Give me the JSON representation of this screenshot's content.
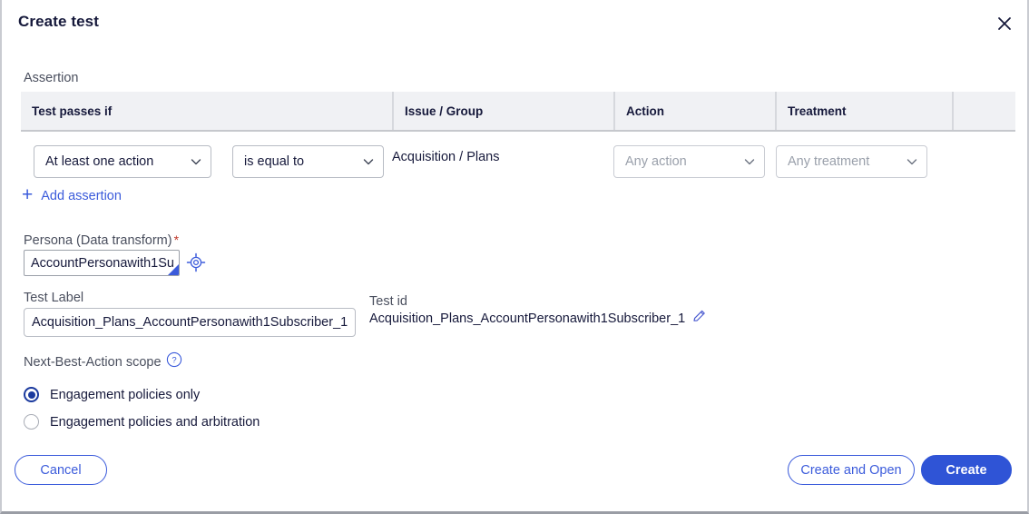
{
  "dialog": {
    "title": "Create test",
    "close_icon": "close-icon"
  },
  "assertion": {
    "section_label": "Assertion",
    "columns": [
      "Test passes if",
      "Issue / Group",
      "Action",
      "Treatment",
      ""
    ],
    "row": {
      "passes_if": "At least one action",
      "operator": "is equal to",
      "issue_group": "Acquisition / Plans",
      "action_placeholder": "Any action",
      "treatment_placeholder": "Any treatment"
    },
    "add_assertion_label": "Add assertion",
    "add_icon": "plus-icon"
  },
  "persona": {
    "label": "Persona (Data transform)",
    "required_mark": "*",
    "value": "AccountPersonawith1Su",
    "target_icon": "crosshair-target-icon"
  },
  "test_label": {
    "label": "Test Label",
    "value": "Acquisition_Plans_AccountPersonawith1Subscriber_1"
  },
  "test_id": {
    "label": "Test id",
    "value": "Acquisition_Plans_AccountPersonawith1Subscriber_1",
    "edit_icon": "pencil-edit-icon"
  },
  "nba_scope": {
    "label": "Next-Best-Action scope",
    "help_icon": "help-circle-icon",
    "options": [
      {
        "label": "Engagement policies only",
        "selected": true
      },
      {
        "label": "Engagement policies and arbitration",
        "selected": false
      }
    ]
  },
  "footer": {
    "cancel": "Cancel",
    "create_and_open": "Create and Open",
    "create": "Create"
  },
  "colors": {
    "accent_blue": "#3b5bdb",
    "primary_button": "#2f54d6",
    "header_bg": "#f0f1f4",
    "text_dark": "#16193b",
    "required_red": "#c0392b",
    "radio_selected": "#1b3a9e"
  }
}
